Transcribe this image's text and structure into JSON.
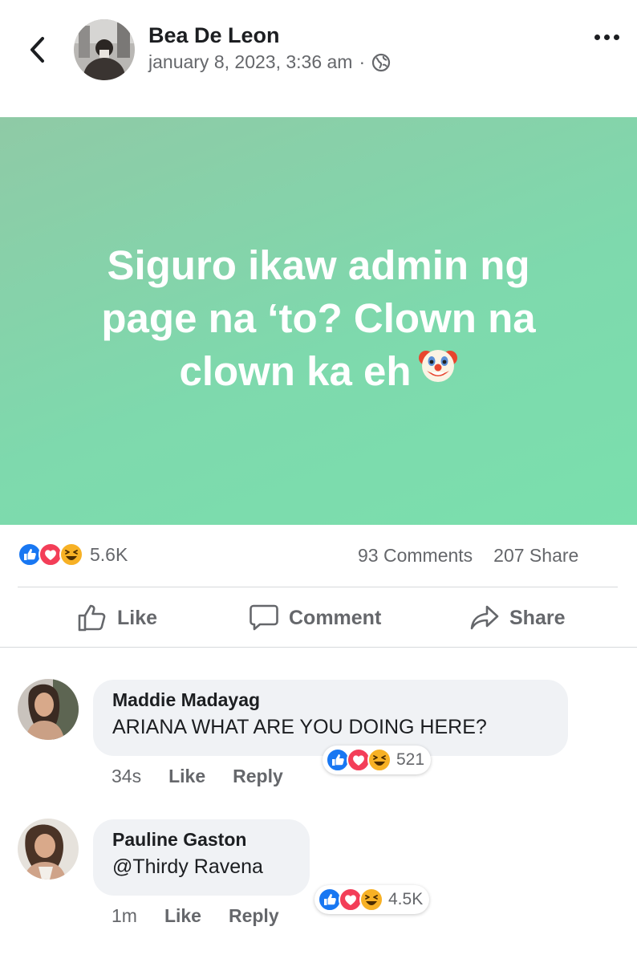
{
  "post": {
    "author": "Bea De Leon",
    "timestamp": "january 8, 2023, 3:36 am",
    "separator": "·",
    "privacy_icon": "globe-icon",
    "text": "Siguro ikaw admin ng page na ‘to? Clown na clown ka eh",
    "emoji": "clown-face-emoji",
    "background_colors": [
      "#8fcaa6",
      "#7adfad"
    ]
  },
  "stats": {
    "reactions": [
      "like",
      "love",
      "haha"
    ],
    "reaction_count": "5.6K",
    "comments": "93 Comments",
    "shares": "207 Share"
  },
  "actions": {
    "like": "Like",
    "comment": "Comment",
    "share": "Share"
  },
  "comments": [
    {
      "name": "Maddie Madayag",
      "text": "ARIANA WHAT ARE YOU DOING HERE?",
      "time": "34s",
      "like": "Like",
      "reply": "Reply",
      "reaction_count": "521"
    },
    {
      "name": "Pauline Gaston",
      "text": "@Thirdy Ravena",
      "time": "1m",
      "like": "Like",
      "reply": "Reply",
      "reaction_count": "4.5K"
    }
  ],
  "colors": {
    "like_blue": "#1877f2",
    "love_red": "#f33e58",
    "haha_yellow": "#f7b125",
    "secondary_text": "#65676b"
  }
}
